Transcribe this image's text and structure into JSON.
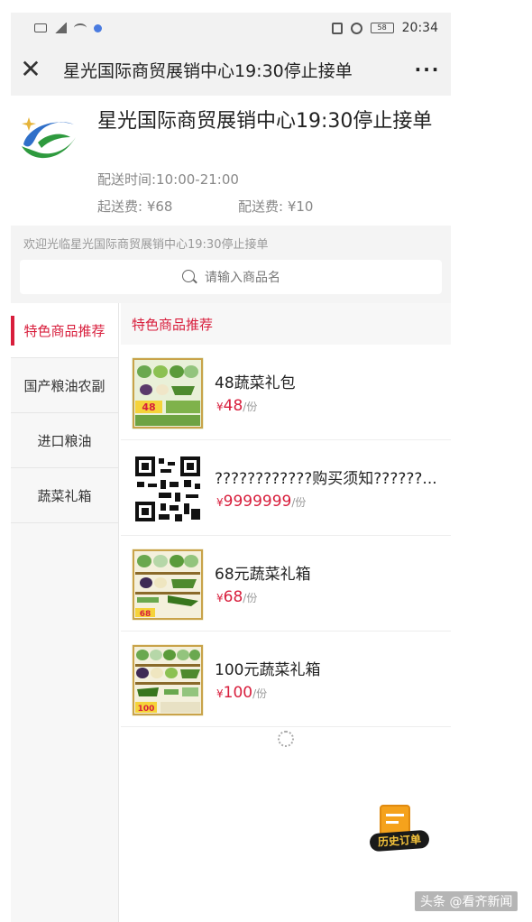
{
  "status_bar": {
    "time": "20:34",
    "battery": "58"
  },
  "nav": {
    "title": "星光国际商贸展销中心19:30停止接单",
    "close_glyph": "✕",
    "more_glyph": "···"
  },
  "store": {
    "name": "星光国际商贸展销中心19:30停止接单",
    "delivery_time": "配送时间:10:00-21:00",
    "min_fee": "起送费: ¥68",
    "delivery_fee": "配送费: ¥10",
    "logo_colors": {
      "green": "#2e9a3e",
      "blue": "#2f6fc9",
      "gold": "#e6b43a"
    }
  },
  "notice": {
    "text": "欢迎光临星光国际商贸展销中心19:30停止接单"
  },
  "search": {
    "placeholder": "请输入商品名"
  },
  "sidebar": {
    "items": [
      {
        "label": "特色商品推荐",
        "active": true
      },
      {
        "label": "国产粮油农副",
        "active": false
      },
      {
        "label": "进口粮油",
        "active": false
      },
      {
        "label": "蔬菜礼箱",
        "active": false
      }
    ]
  },
  "main": {
    "section_title": "特色商品推荐",
    "products": [
      {
        "name": "48蔬菜礼包",
        "currency": "¥",
        "price": "48",
        "unit": "/份",
        "thumb_tag": "48"
      },
      {
        "name": "????????????购买须知??????...",
        "currency": "¥",
        "price": "9999999",
        "unit": "/份",
        "thumb_tag": ""
      },
      {
        "name": "68元蔬菜礼箱",
        "currency": "¥",
        "price": "68",
        "unit": "/份",
        "thumb_tag": "68"
      },
      {
        "name": "100元蔬菜礼箱",
        "currency": "¥",
        "price": "100",
        "unit": "/份",
        "thumb_tag": "100"
      }
    ]
  },
  "order_button": {
    "label": "历史订单"
  },
  "watermark": {
    "text": "头条 @看齐新闻"
  },
  "colors": {
    "accent": "#d81e3c",
    "panel_bg": "#f2f2f2"
  }
}
